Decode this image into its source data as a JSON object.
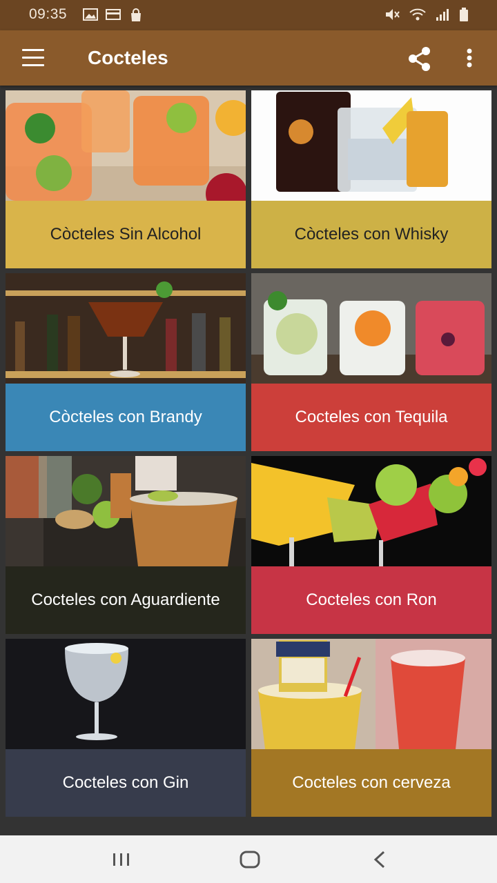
{
  "status_bar": {
    "time": "09:35",
    "left_icons": [
      "image-icon",
      "card-icon",
      "bag-icon"
    ],
    "right_icons": [
      "mute-icon",
      "wifi-icon",
      "signal-icon",
      "battery-icon"
    ]
  },
  "app_bar": {
    "title": "Cocteles",
    "icons": [
      "menu-icon",
      "share-icon",
      "more-vert-icon"
    ]
  },
  "categories": [
    {
      "label": "Còcteles Sin Alcohol",
      "color": "#d9b44a",
      "text_color": "#222222"
    },
    {
      "label": "Còcteles con Whisky",
      "color": "#cdb146",
      "text_color": "#222222"
    },
    {
      "label": "Còcteles con Brandy",
      "color": "#3a87b6",
      "text_color": "#ffffff"
    },
    {
      "label": "Cocteles con Tequila",
      "color": "#cc3f3a",
      "text_color": "#ffffff"
    },
    {
      "label": "Cocteles con Aguardiente",
      "color": "#25261c",
      "text_color": "#ffffff"
    },
    {
      "label": "Cocteles con Ron",
      "color": "#c73445",
      "text_color": "#ffffff"
    },
    {
      "label": "Cocteles con Gin",
      "color": "#373c4c",
      "text_color": "#ffffff"
    },
    {
      "label": "Cocteles con cerveza",
      "color": "#a37724",
      "text_color": "#ffffff"
    }
  ],
  "nav_bar": {
    "icons": [
      "recents-icon",
      "home-icon",
      "back-icon"
    ]
  }
}
